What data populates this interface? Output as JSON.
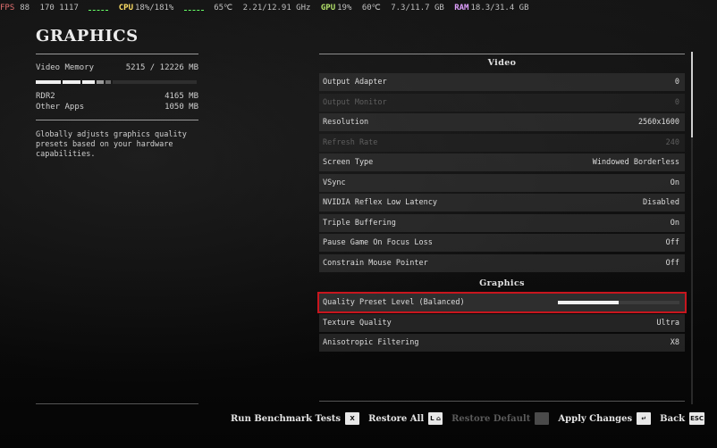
{
  "osd": {
    "fps_label": "FPS",
    "fps_value": "88",
    "frametime": "170 1117",
    "cpu_label": "CPU",
    "cpu_value": "18%/181%",
    "cpu_temp": "65℃",
    "cpu_clock": "2.21/12.91 GHz",
    "gpu_label": "GPU",
    "gpu_value": "19%",
    "gpu_temp": "60℃",
    "gpu_mem": "7.3/11.7 GB",
    "ram_label": "RAM",
    "ram_value": "18.3/31.4 GB"
  },
  "left": {
    "title": "GRAPHICS",
    "video_memory_label": "Video Memory",
    "video_memory_value": "5215 / 12226 MB",
    "rdr2_label": "RDR2",
    "rdr2_value": "4165 MB",
    "other_apps_label": "Other Apps",
    "other_apps_value": "1050 MB",
    "description": "Globally adjusts graphics quality presets based on your hardware capabilities."
  },
  "video": {
    "header": "Video",
    "rows": [
      {
        "label": "Output Adapter",
        "value": "0"
      },
      {
        "label": "Output Monitor",
        "value": "0"
      },
      {
        "label": "Resolution",
        "value": "2560x1600"
      },
      {
        "label": "Refresh Rate",
        "value": "240"
      },
      {
        "label": "Screen Type",
        "value": "Windowed Borderless"
      },
      {
        "label": "VSync",
        "value": "On"
      },
      {
        "label": "NVIDIA Reflex Low Latency",
        "value": "Disabled"
      },
      {
        "label": "Triple Buffering",
        "value": "On"
      },
      {
        "label": "Pause Game On Focus Loss",
        "value": "Off"
      },
      {
        "label": "Constrain Mouse Pointer",
        "value": "Off"
      }
    ]
  },
  "graphics": {
    "header": "Graphics",
    "quality_preset": {
      "label": "Quality Preset Level (Balanced)",
      "level": 0.5
    },
    "rows": [
      {
        "label": "Texture Quality",
        "value": "Ultra"
      },
      {
        "label": "Anisotropic Filtering",
        "value": "X8"
      }
    ]
  },
  "actions": {
    "benchmark": {
      "label": "Run Benchmark Tests",
      "key": "X"
    },
    "restore_all": {
      "label": "Restore All",
      "key": "L ⌂"
    },
    "restore_default": {
      "label": "Restore Default",
      "key": "___"
    },
    "apply": {
      "label": "Apply Changes",
      "key": "↵"
    },
    "back": {
      "label": "Back",
      "key": "ESC"
    }
  }
}
